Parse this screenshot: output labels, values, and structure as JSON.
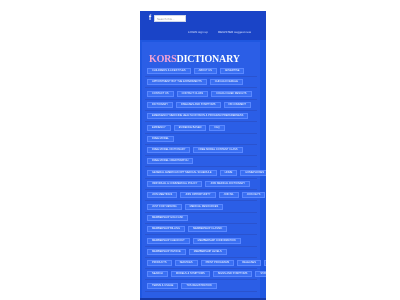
{
  "topbar": {
    "fb_icon_glyph": "f",
    "search_placeholder": "Search this...",
    "login": "LOGIN  sign up",
    "register": "REGISTER  suggest new"
  },
  "logo": {
    "brand": "KORS",
    "rest": "DICTIONARY"
  },
  "tag_rows": [
    [
      "CHILDRENS & LIFESTYLES",
      "ABOUT US",
      "ADVERTISE"
    ],
    [
      "APPOINTMENT BUT THE EXPERIMENTS",
      "CHICAGO FEMALE"
    ],
    [
      "CONTACT US",
      "CONTACT CLASS",
      "COACH CHIEF RESULTS"
    ],
    [
      "DICTIONARY",
      "DISEASES AND SYMPTOMS",
      "FB COMMENT"
    ],
    [
      "EMERGENCY MEDICINE HEALTH DIVISION & PROGRAM PREPAREDNESS"
    ],
    [
      "EMINENCY",
      "EVIDENCE BASED",
      "FAQ"
    ],
    [
      "FREE MODEL"
    ],
    [
      "FREE MODEL DICTIONARY",
      "FREE MODEL CONTENT CLASS"
    ],
    [
      "FREE MODEL CREDITWATCH"
    ],
    [
      "GENERAL AMERICAN OPT MEDICAL SCHEDULE",
      "HOME",
      "HOMEPHONES"
    ],
    [
      "INDIVIDUAL & COMMERCIAL POLICY",
      "JOIN MEDICAL DICTIONARY"
    ],
    [
      "JOIN MEETINGS",
      "JOIN OPPORTUNITY",
      "JOIN ML",
      "JOIN KEYS"
    ],
    [
      "JUST FOR VIEWING",
      "MEDICAL RESOURCES"
    ],
    [
      "MEMBERSHIP GOLD ASK"
    ],
    [
      "MEMBERSHIP BILLING",
      "MEMBERSHIP CLASSIC"
    ],
    [
      "MEMBERSHIP CHECKOUT",
      "MEMBERSHIP CONFIRMATION"
    ],
    [
      "MEMBERSHIP INVOICE",
      "MEMBERSHIP LEVELS"
    ],
    [
      "PRODUCTS",
      "SERVICES",
      "PRINT PROGRAMS",
      "RELEASES",
      "SECURE LOGIN"
    ],
    [
      "SEARCH",
      "MODELS & SYMPTOMS",
      "SIGNS AND SYMPTOMS",
      "STANDING"
    ],
    [
      "TERMS & USAGE",
      "TOS REGISTRATION"
    ]
  ]
}
